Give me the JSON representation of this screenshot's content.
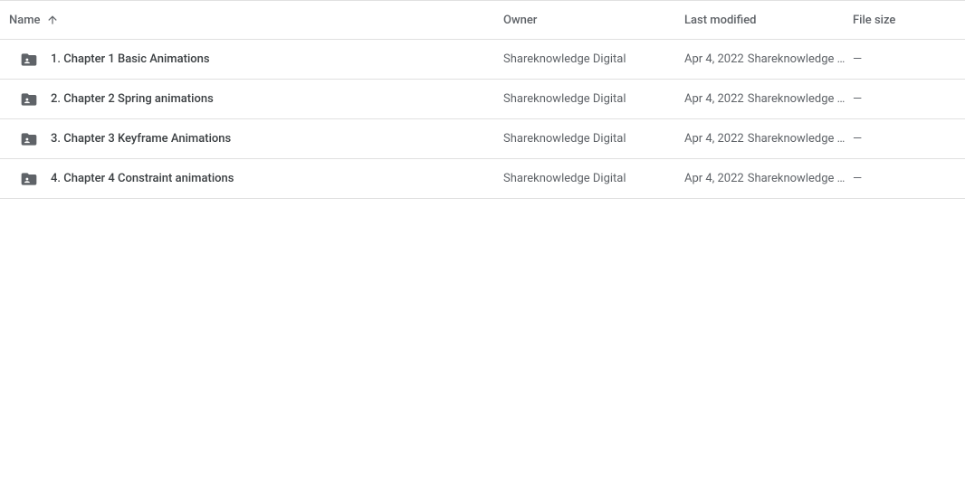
{
  "columns": {
    "name": "Name",
    "owner": "Owner",
    "modified": "Last modified",
    "size": "File size"
  },
  "rows": [
    {
      "name": "1. Chapter 1 Basic Animations",
      "owner": "Shareknowledge Digital",
      "modified_date": "Apr 4, 2022",
      "modified_by": "Shareknowledge D…",
      "size": "—"
    },
    {
      "name": "2. Chapter 2 Spring animations",
      "owner": "Shareknowledge Digital",
      "modified_date": "Apr 4, 2022",
      "modified_by": "Shareknowledge D…",
      "size": "—"
    },
    {
      "name": "3. Chapter 3 Keyframe Animations",
      "owner": "Shareknowledge Digital",
      "modified_date": "Apr 4, 2022",
      "modified_by": "Shareknowledge D…",
      "size": "—"
    },
    {
      "name": "4. Chapter 4 Constraint animations",
      "owner": "Shareknowledge Digital",
      "modified_date": "Apr 4, 2022",
      "modified_by": "Shareknowledge D…",
      "size": "—"
    }
  ]
}
